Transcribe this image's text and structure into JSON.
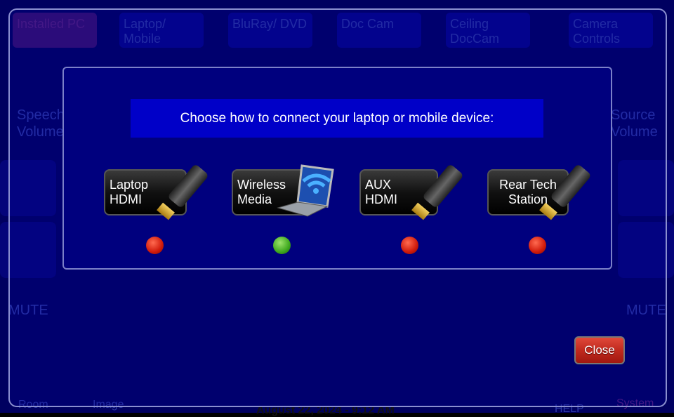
{
  "background": {
    "sources": [
      "Installed PC",
      "Laptop/ Mobile",
      "BluRay/ DVD",
      "Doc Cam",
      "Ceiling DocCam",
      "Camera Controls"
    ],
    "speech_volume": "Speech Volume",
    "source_volume": "Source Volume",
    "mute": "MUTE",
    "room": "Room",
    "image": "Image",
    "datetime": "August 22, 2024 - 9:12 AM",
    "help": "HELP",
    "system": "System"
  },
  "dialog": {
    "title": "Choose how to connect your laptop or mobile device:",
    "options": [
      {
        "line1": "Laptop",
        "line2": "HDMI",
        "icon": "hdmi-cable-icon",
        "status": "red"
      },
      {
        "line1": "Wireless",
        "line2": "Media",
        "icon": "wireless-laptop-icon",
        "status": "green"
      },
      {
        "line1": "AUX",
        "line2": "HDMI",
        "icon": "hdmi-cable-icon",
        "status": "red"
      },
      {
        "line1": "Rear Tech",
        "line2": "Station",
        "icon": "hdmi-cable-icon",
        "status": "red"
      }
    ],
    "close_label": "Close"
  },
  "colors": {
    "status_active": "#3ea81e",
    "status_inactive": "#d01a0a",
    "title_bar": "#0000c8"
  }
}
